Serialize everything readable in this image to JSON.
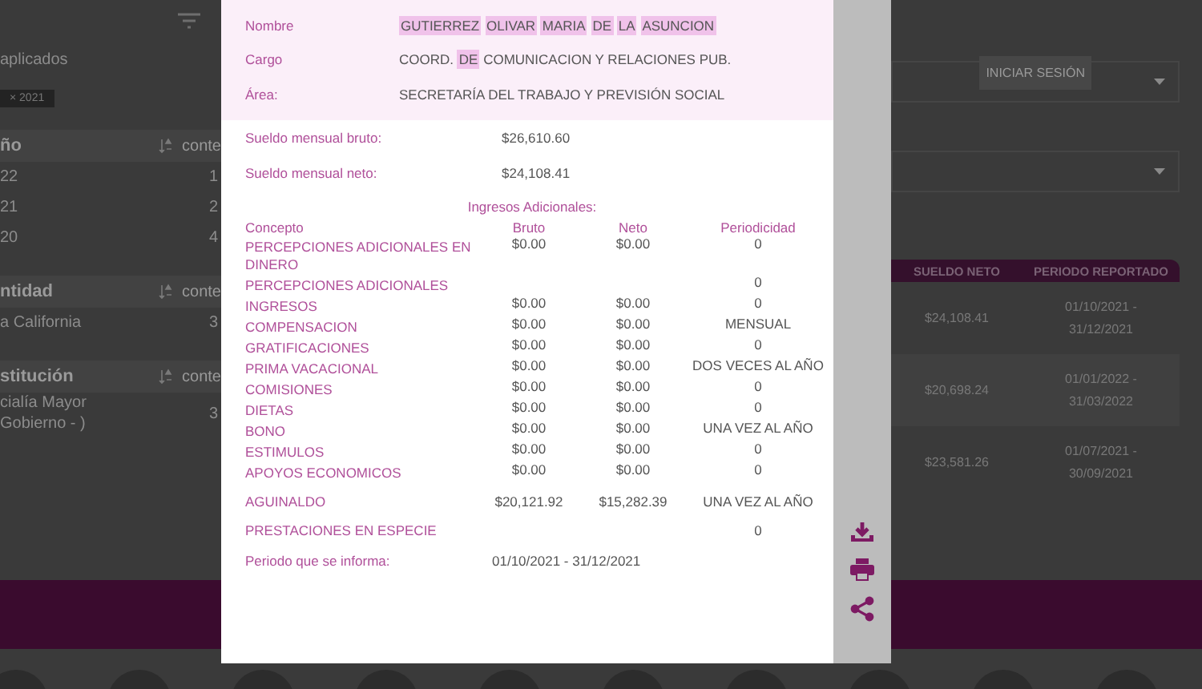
{
  "background_page": {
    "left_panel": {
      "filters_label": "aplicados",
      "filter_chip": "× 2021",
      "facets": [
        {
          "title": "ño",
          "count_header": "conte",
          "rows": [
            {
              "label": "22",
              "count": "1"
            },
            {
              "label": "21",
              "count": "2"
            },
            {
              "label": "20",
              "count": "4"
            }
          ]
        },
        {
          "title": "ntidad",
          "count_header": "conte",
          "rows": [
            {
              "label": "a California",
              "count": "3"
            }
          ]
        },
        {
          "title": "stitución",
          "count_header": "conte",
          "rows": [
            {
              "label": "cialía Mayor Gobierno - )",
              "count": "3"
            }
          ]
        }
      ]
    },
    "right_panel": {
      "login_button": "INICIAR SESIÓN",
      "results_table": {
        "columns": [
          "SUELDO NETO",
          "PERIODO REPORTADO"
        ],
        "rows": [
          {
            "cells": [
              "$24,108.41",
              "01/10/2021 - 31/12/2021"
            ]
          },
          {
            "cells": [
              "$20,698.24",
              "01/01/2022 - 31/03/2022"
            ]
          },
          {
            "cells": [
              "$23,581.26",
              "01/07/2021 - 30/09/2021"
            ]
          }
        ]
      }
    }
  },
  "modal": {
    "header_fields": [
      {
        "label": "Nombre",
        "parts": [
          {
            "text": "GUTIERREZ",
            "highlighted": true
          },
          {
            "text": "OLIVAR",
            "highlighted": true
          },
          {
            "text": "MARIA",
            "highlighted": true
          },
          {
            "text": "DE",
            "highlighted": true
          },
          {
            "text": "LA",
            "highlighted": true
          },
          {
            "text": "ASUNCION",
            "highlighted": true
          }
        ]
      },
      {
        "label": "Cargo",
        "parts": [
          {
            "text": "COORD.",
            "highlighted": false
          },
          {
            "text": "DE",
            "highlighted": true
          },
          {
            "text": "COMUNICACION Y RELACIONES PUB.",
            "highlighted": false
          }
        ]
      },
      {
        "label": "Área:",
        "parts": [
          {
            "text": "SECRETARÍA DEL TRABAJO Y PREVISIÓN SOCIAL",
            "highlighted": false
          }
        ]
      }
    ],
    "salary_fields": [
      {
        "label": "Sueldo mensual bruto:",
        "value": "$26,610.60"
      },
      {
        "label": "Sueldo mensual neto:",
        "value": "$24,108.41"
      }
    ],
    "section_title": "Ingresos Adicionales:",
    "columns": [
      "Concepto",
      "Bruto",
      "Neto",
      "Periodicidad"
    ],
    "rows": [
      {
        "concept": "PERCEPCIONES ADICIONALES EN DINERO",
        "bruto": "$0.00",
        "neto": "$0.00",
        "periodicidad": "0"
      },
      {
        "concept": "PERCEPCIONES ADICIONALES",
        "periodicidad": "0"
      },
      {
        "concept": "INGRESOS",
        "bruto": "$0.00",
        "neto": "$0.00",
        "periodicidad": "0"
      },
      {
        "concept": "COMPENSACION",
        "bruto": "$0.00",
        "neto": "$0.00",
        "periodicidad": "MENSUAL"
      },
      {
        "concept": "GRATIFICACIONES",
        "bruto": "$0.00",
        "neto": "$0.00",
        "periodicidad": "0"
      },
      {
        "concept": "PRIMA VACACIONAL",
        "bruto": "$0.00",
        "neto": "$0.00",
        "periodicidad": "DOS VECES AL AÑO"
      },
      {
        "concept": "COMISIONES",
        "bruto": "$0.00",
        "neto": "$0.00",
        "periodicidad": "0"
      },
      {
        "concept": "DIETAS",
        "bruto": "$0.00",
        "neto": "$0.00",
        "periodicidad": "0"
      },
      {
        "concept": "BONO",
        "bruto": "$0.00",
        "neto": "$0.00",
        "periodicidad": "UNA VEZ AL AÑO"
      },
      {
        "concept": "ESTIMULOS",
        "bruto": "$0.00",
        "neto": "$0.00",
        "periodicidad": "0"
      },
      {
        "concept": "APOYOS ECONOMICOS",
        "bruto": "$0.00",
        "neto": "$0.00",
        "periodicidad": "0"
      },
      {
        "concept": "AGUINALDO",
        "bruto": "$20,121.92",
        "neto": "$15,282.39",
        "periodicidad": "UNA VEZ AL AÑO"
      },
      {
        "concept": "PRESTACIONES EN ESPECIE",
        "periodicidad": "0"
      }
    ],
    "period": {
      "label": "Periodo que se informa:",
      "value": "01/10/2021 - 31/12/2021"
    }
  }
}
